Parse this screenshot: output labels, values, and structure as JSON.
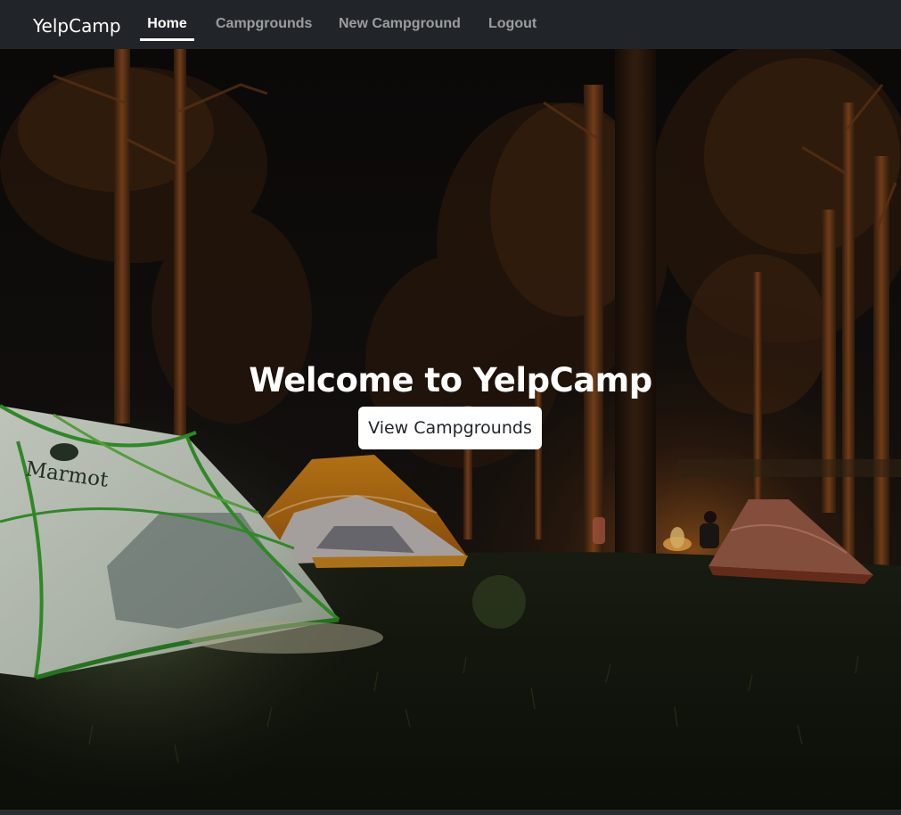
{
  "navbar": {
    "brand": "YelpCamp",
    "links": [
      {
        "label": "Home",
        "active": true
      },
      {
        "label": "Campgrounds",
        "active": false
      },
      {
        "label": "New Campground",
        "active": false
      },
      {
        "label": "Logout",
        "active": false
      }
    ]
  },
  "hero": {
    "title": "Welcome to YelpCamp",
    "button_label": "View Campgrounds",
    "tent_logo_text": "Marmot"
  },
  "colors": {
    "navbar_bg": "#212529",
    "button_bg": "#ffffff",
    "text_light": "#ffffff"
  }
}
